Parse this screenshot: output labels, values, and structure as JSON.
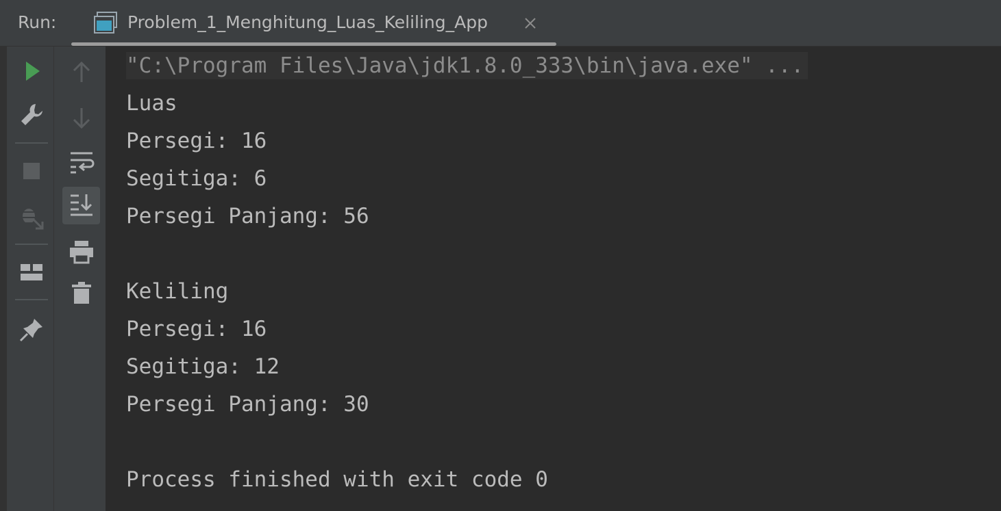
{
  "header": {
    "run_label": "Run:",
    "tab_label": "Problem_1_Menghitung_Luas_Keliling_App",
    "tab_icon": "console-window-icon",
    "close_icon": "close-icon"
  },
  "toolbar_left": [
    {
      "name": "rerun-icon",
      "color": "#499c54"
    },
    {
      "name": "wrench-icon"
    },
    {
      "name": "stop-icon"
    },
    {
      "name": "debug-exit-icon"
    },
    {
      "name": "layout-icon"
    },
    {
      "name": "pin-icon"
    }
  ],
  "toolbar_second": [
    {
      "name": "up-arrow-icon"
    },
    {
      "name": "down-arrow-icon"
    },
    {
      "name": "soft-wrap-icon"
    },
    {
      "name": "scroll-to-end-icon",
      "active": true
    },
    {
      "name": "print-icon"
    },
    {
      "name": "trash-icon"
    }
  ],
  "console": {
    "command": "\"C:\\Program Files\\Java\\jdk1.8.0_333\\bin\\java.exe\" ...",
    "lines": [
      "Luas",
      "Persegi: 16",
      "Segitiga: 6",
      "Persegi Panjang: 56",
      "",
      "Keliling",
      "Persegi: 16",
      "Segitiga: 12",
      "Persegi Panjang: 30",
      "",
      "Process finished with exit code 0"
    ]
  },
  "colors": {
    "background": "#2b2b2b",
    "panel": "#3c3f41",
    "text": "#bbbbbb",
    "run_green": "#499c54"
  }
}
